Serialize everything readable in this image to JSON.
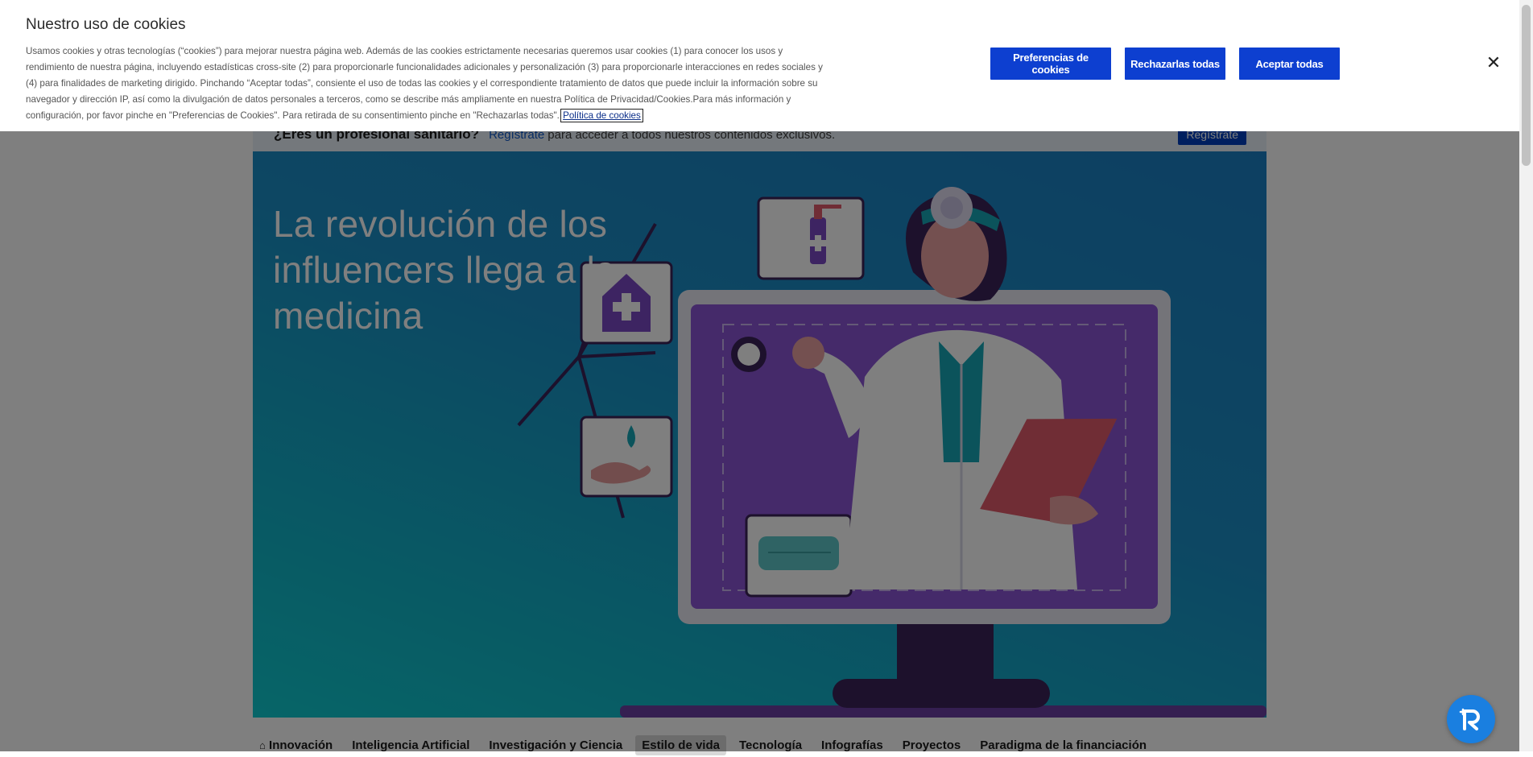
{
  "cookie_banner": {
    "title": "Nuestro uso de cookies",
    "text": "Usamos cookies y otras tecnologías (“cookies”) para mejorar nuestra página web. Además de las cookies estrictamente necesarias queremos usar cookies (1) para conocer los usos y rendimiento de nuestra página, incluyendo estadísticas cross-site (2) para proporcionarle funcionalidades adicionales y personalización (3) para proporcionarle interacciones en redes sociales y (4) para finalidades de marketing dirigido. Pinchando “Aceptar todas”, consiente el uso de todas las cookies y el correspondiente tratamiento de datos que puede incluir la información sobre su navegador y dirección IP, así como la divulgación de datos personales a terceros, como se describe más ampliamente en nuestra Política de Privacidad/Cookies.Para más información y configuración, por favor pinche en \"Preferencias de Cookies\". Para retirada de su consentimiento pinche en \"Rechazarlas todas\".",
    "policy_link": "Política de cookies",
    "btn_preferences": "Preferencias de cookies",
    "btn_reject": "Rechazarlas todas",
    "btn_accept": "Aceptar todas",
    "close_glyph": "✕"
  },
  "pro_banner": {
    "question": "¿Eres un profesional sanitario?",
    "link": "Regístrate",
    "rest": "para acceder a todos nuestros contenidos exclusivos.",
    "button": "Regístrate"
  },
  "hero": {
    "title": "La revolución de los influencers llega a la medicina"
  },
  "tabs": [
    {
      "label": "Innovación",
      "icon": "home-icon"
    },
    {
      "label": "Inteligencia Artificial"
    },
    {
      "label": "Investigación y Ciencia"
    },
    {
      "label": "Estilo de vida",
      "active": true
    },
    {
      "label": "Tecnología"
    },
    {
      "label": "Infografías"
    },
    {
      "label": "Proyectos"
    },
    {
      "label": "Paradigma de la financiación"
    }
  ],
  "colors": {
    "accent": "#0d3fd0",
    "overlay": "rgba(0,0,0,0.5)",
    "chat_fab": "#1a7fe0"
  }
}
